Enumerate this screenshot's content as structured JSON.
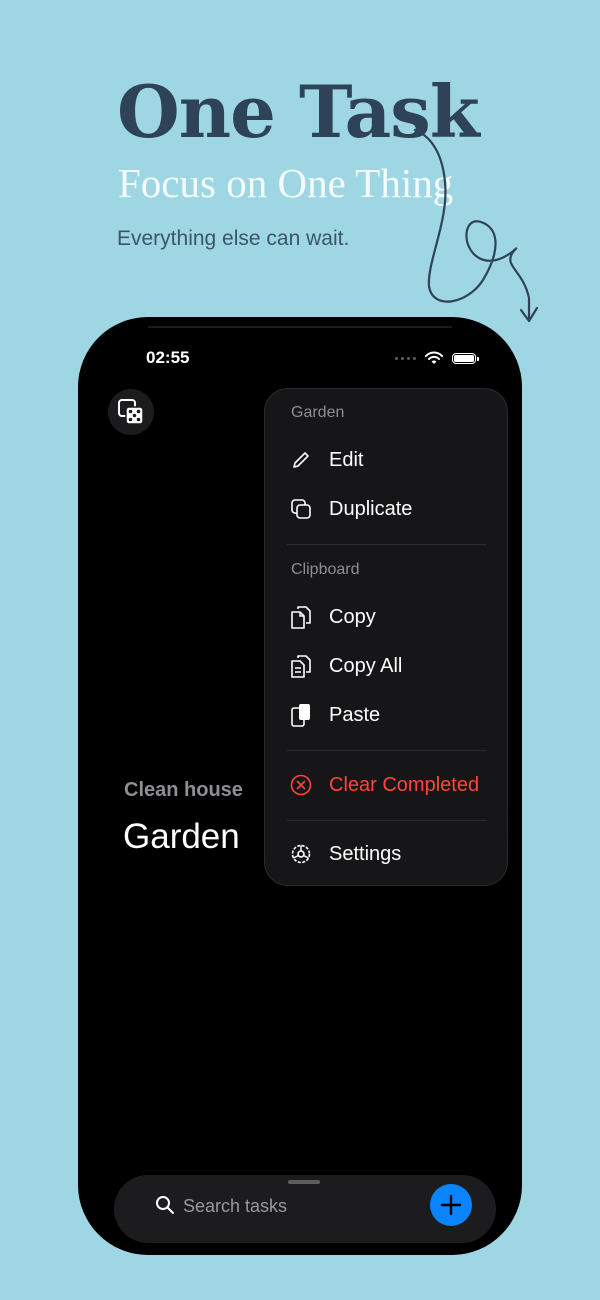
{
  "hero": {
    "title": "One Task",
    "subtitle": "Focus on One Thing",
    "tagline": "Everything else can wait."
  },
  "status_bar": {
    "time": "02:55"
  },
  "task": {
    "parent": "Clean house",
    "current": "Garden"
  },
  "menu": {
    "section1_title": "Garden",
    "edit": "Edit",
    "duplicate": "Duplicate",
    "section2_title": "Clipboard",
    "copy": "Copy",
    "copy_all": "Copy All",
    "paste": "Paste",
    "clear_completed": "Clear Completed",
    "settings": "Settings"
  },
  "search": {
    "placeholder": "Search tasks"
  },
  "colors": {
    "background": "#9fd6e3",
    "title": "#2e4357",
    "accent_blue": "#0a84ff",
    "destructive": "#ff453a"
  },
  "icons": [
    "dice-icon",
    "pencil-icon",
    "duplicate-icon",
    "copy-icon",
    "copy-all-icon",
    "paste-icon",
    "clear-icon",
    "gear-icon",
    "search-icon",
    "plus-icon",
    "wifi-icon",
    "battery-icon"
  ]
}
